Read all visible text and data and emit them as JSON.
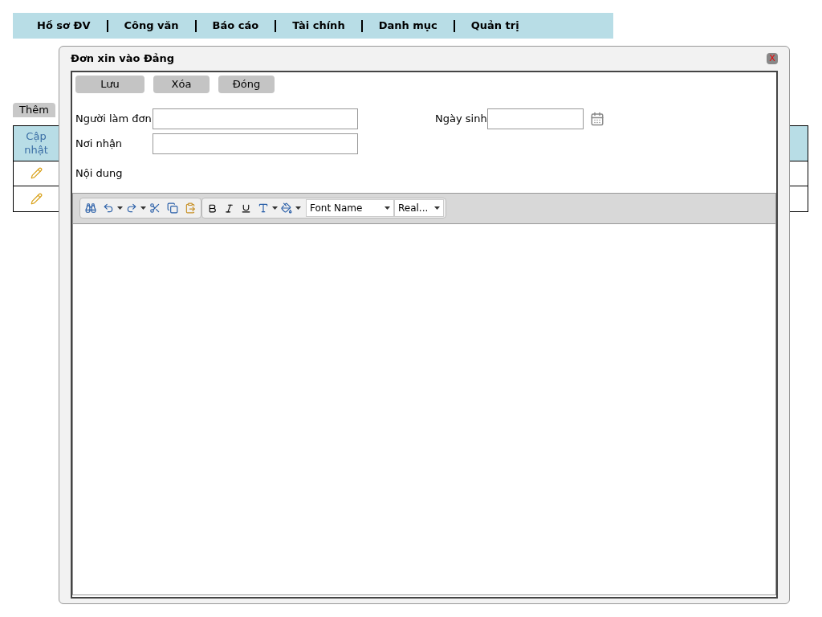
{
  "nav": {
    "items": [
      "Hồ sơ ĐV",
      "Công văn",
      "Báo cáo",
      "Tài chính",
      "Danh mục",
      "Quản trị"
    ]
  },
  "background": {
    "add_button": "Thêm",
    "table": {
      "columns": [
        "Cập nhật"
      ],
      "rows": [
        {
          "kind": "edit"
        },
        {
          "kind": "edit"
        }
      ]
    }
  },
  "dialog": {
    "title": "Đơn xin vào Đảng",
    "close": "X",
    "buttons": [
      "Lưu",
      "Xóa",
      "Đóng"
    ],
    "fields": [
      {
        "label": "Người làm đơn",
        "kind": "text"
      },
      {
        "label": "Ngày sinh",
        "kind": "date"
      },
      {
        "label": "Nơi nhận",
        "kind": "text"
      }
    ],
    "editor": {
      "label": "Nội dung",
      "font_name": "Font Name",
      "font_size": "Real..."
    }
  }
}
